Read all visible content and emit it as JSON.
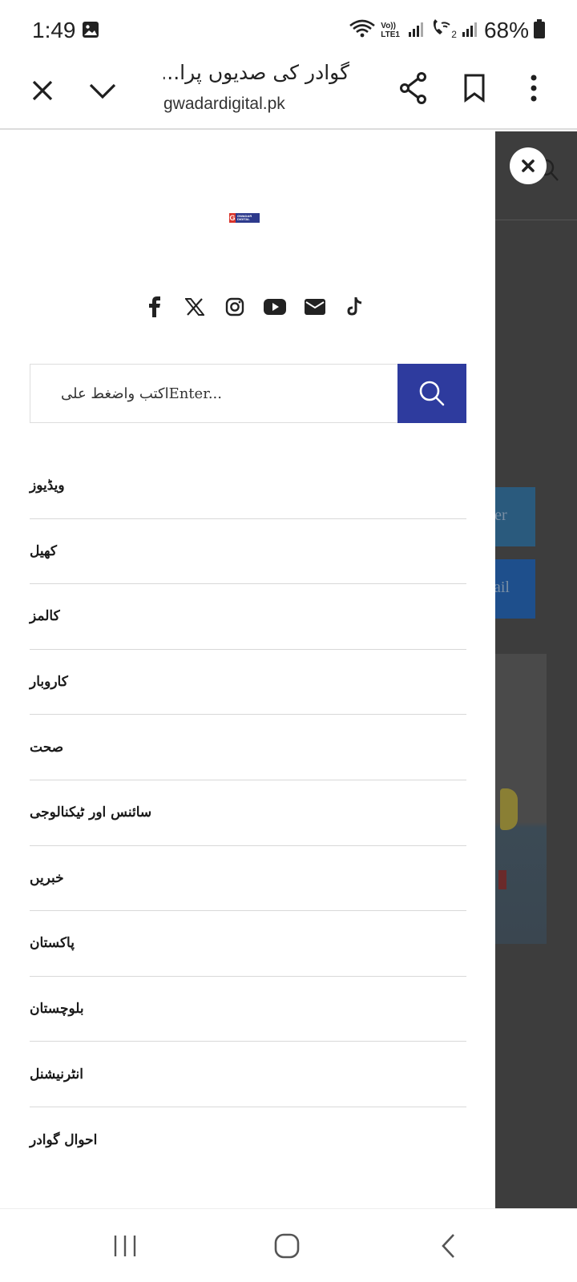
{
  "status_bar": {
    "time": "1:49",
    "network_label": "Vo)) LTE1",
    "sim2_label": "2",
    "battery": "68%"
  },
  "toolbar": {
    "page_title": "گوادر کی صدیوں پرا...",
    "url": "gwadardigital.pk"
  },
  "drawer": {
    "logo_letter": "G",
    "logo_text": "GWADAR DIGITAL",
    "social_icons": [
      "facebook-icon",
      "x-icon",
      "instagram-icon",
      "youtube-icon",
      "email-icon",
      "tiktok-icon"
    ],
    "search": {
      "placeholder": "اکتب واضغط علىEnter..."
    },
    "menu": [
      "ویڈیوز",
      "کھیل",
      "کالمز",
      "کاروبار",
      "صحت",
      "سائنس اور ٹیکنالوجی",
      "خبریں",
      "پاکستان",
      "بلوچستان",
      "انٹرنیشنل",
      "احوال گوادر"
    ]
  },
  "background_page": {
    "button_1_text": "tter",
    "button_2_text": "nail"
  },
  "colors": {
    "search_button": "#2e3b9e",
    "overlay": "#3d3d3d",
    "logo_blue": "#2d3a8c",
    "logo_red": "#d9342b"
  }
}
